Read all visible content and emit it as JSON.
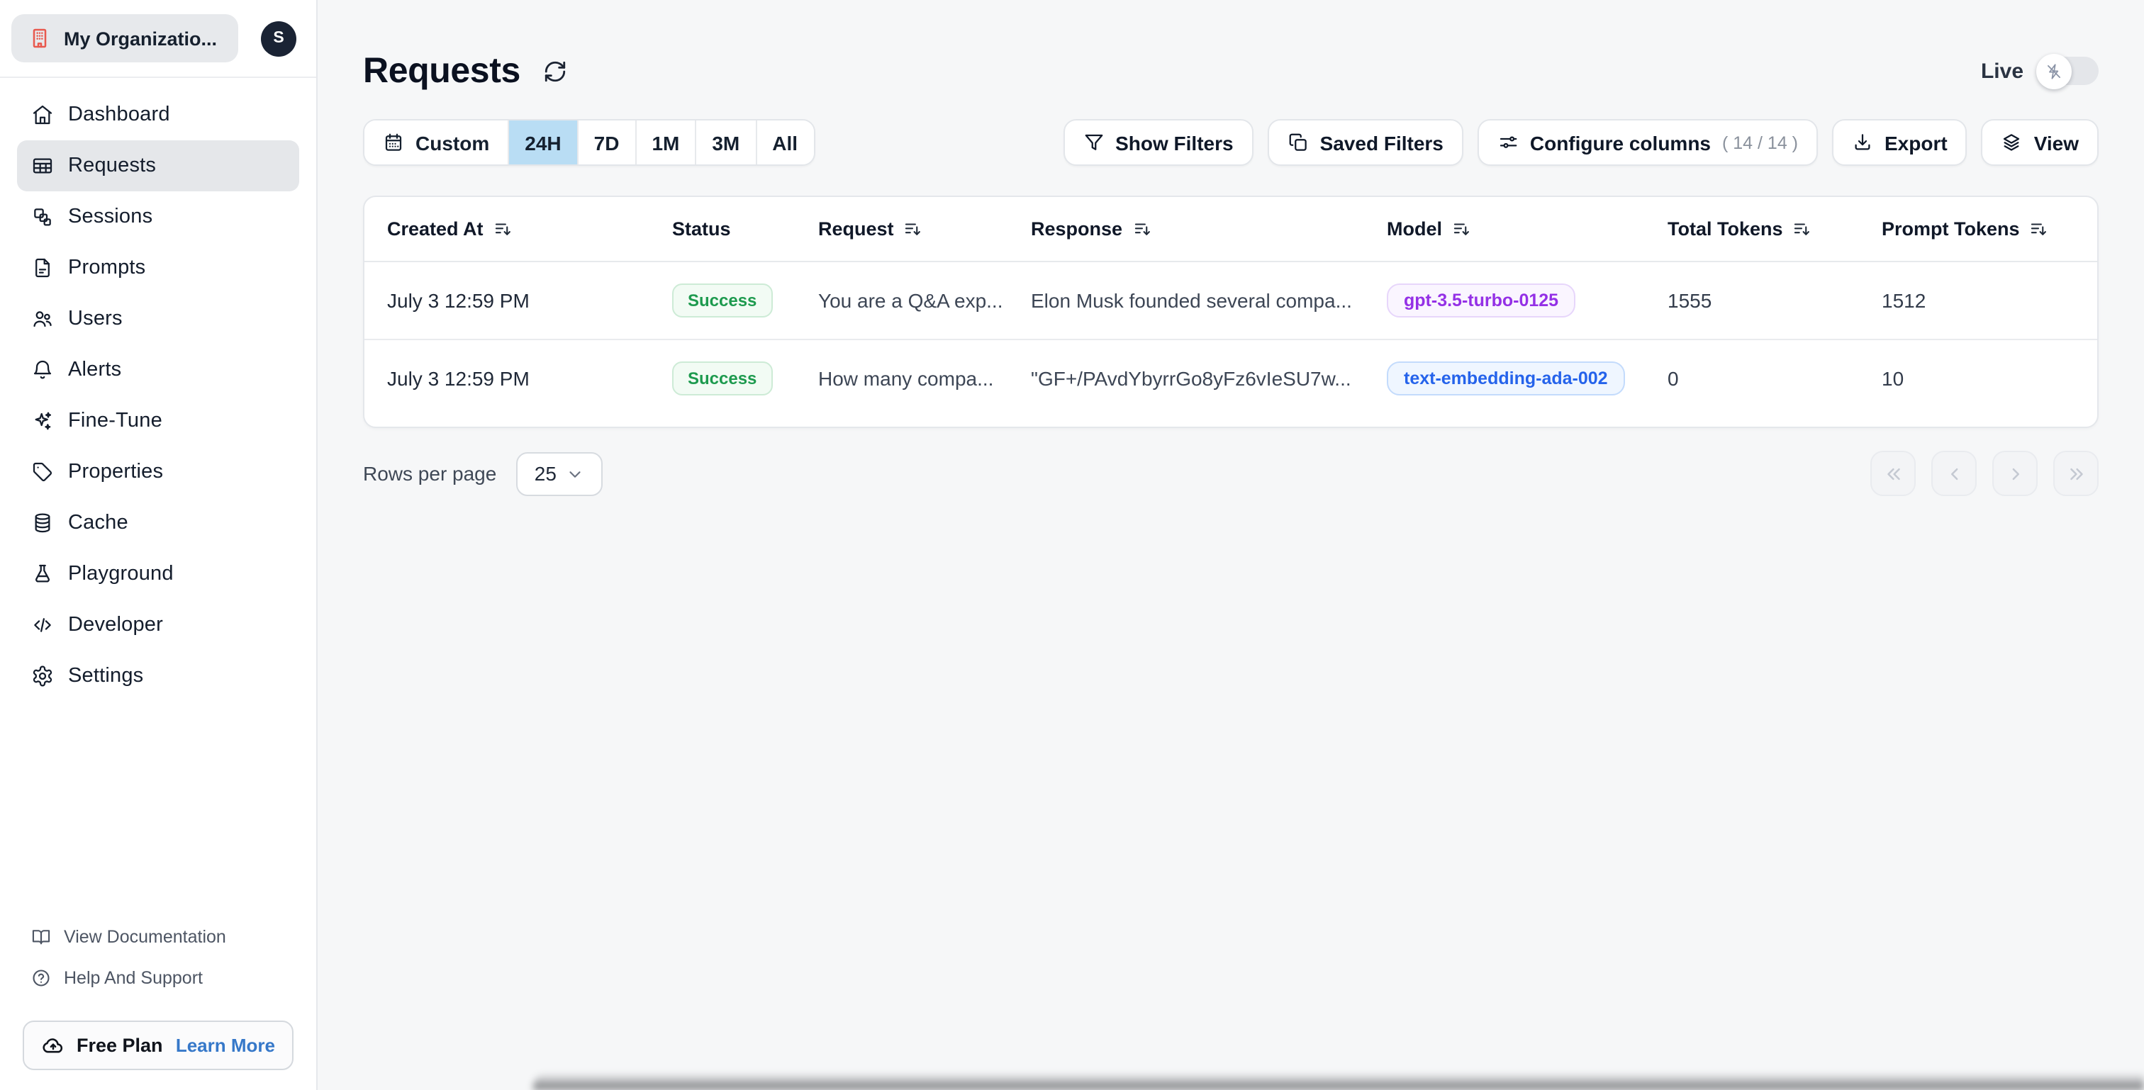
{
  "colors": {
    "page_bg": "#f6f7f8",
    "sidebar_bg": "#ffffff",
    "selected_range_bg": "#b9ddf4",
    "org_icon_color": "#e8594e",
    "success_text": "#1d9a4e",
    "model_purple": "#9430e6",
    "model_blue": "#2563eb",
    "learn_more_blue": "#3678c9"
  },
  "sidebar": {
    "org": {
      "name": "My Organizatio...",
      "avatar_initial": "S",
      "org_icon": "building-icon"
    },
    "items": [
      {
        "label": "Dashboard",
        "icon": "home-icon",
        "active": false
      },
      {
        "label": "Requests",
        "icon": "table-icon",
        "active": true
      },
      {
        "label": "Sessions",
        "icon": "sessions-icon",
        "active": false
      },
      {
        "label": "Prompts",
        "icon": "document-icon",
        "active": false
      },
      {
        "label": "Users",
        "icon": "users-icon",
        "active": false
      },
      {
        "label": "Alerts",
        "icon": "bell-icon",
        "active": false
      },
      {
        "label": "Fine-Tune",
        "icon": "sparkles-icon",
        "active": false
      },
      {
        "label": "Properties",
        "icon": "tag-icon",
        "active": false
      },
      {
        "label": "Cache",
        "icon": "database-icon",
        "active": false
      },
      {
        "label": "Playground",
        "icon": "flask-icon",
        "active": false
      },
      {
        "label": "Developer",
        "icon": "code-icon",
        "active": false
      },
      {
        "label": "Settings",
        "icon": "gear-icon",
        "active": false
      }
    ],
    "footer_links": [
      {
        "label": "View Documentation",
        "icon": "book-open-icon"
      },
      {
        "label": "Help And Support",
        "icon": "help-circle-icon"
      }
    ],
    "plan": {
      "label": "Free Plan",
      "icon": "cloud-upload-icon",
      "action": "Learn More"
    }
  },
  "header": {
    "title": "Requests",
    "refresh_icon": "refresh-icon",
    "live": {
      "label": "Live",
      "enabled": false,
      "knob_icon": "flash-slash-icon"
    }
  },
  "time_range": {
    "custom_label": "Custom",
    "custom_icon": "calendar-icon",
    "options": [
      "24H",
      "7D",
      "1M",
      "3M",
      "All"
    ],
    "selected": "24H"
  },
  "toolbar": {
    "show_filters": "Show Filters",
    "saved_filters": "Saved Filters",
    "configure_columns": "Configure columns",
    "configure_columns_count": "( 14 / 14 )",
    "export": "Export",
    "view": "View"
  },
  "table": {
    "columns": [
      {
        "label": "Created At",
        "sortable": true
      },
      {
        "label": "Status",
        "sortable": false
      },
      {
        "label": "Request",
        "sortable": true
      },
      {
        "label": "Response",
        "sortable": true
      },
      {
        "label": "Model",
        "sortable": true
      },
      {
        "label": "Total Tokens",
        "sortable": true
      },
      {
        "label": "Prompt Tokens",
        "sortable": true
      }
    ],
    "rows": [
      {
        "created_at": "July 3 12:59 PM",
        "status": "Success",
        "request": "You are a Q&A exp...",
        "response": "Elon Musk founded several compa...",
        "model": "gpt-3.5-turbo-0125",
        "model_color": "purple",
        "total_tokens": "1555",
        "prompt_tokens": "1512"
      },
      {
        "created_at": "July 3 12:59 PM",
        "status": "Success",
        "request": "How many compa...",
        "response": "\"GF+/PAvdYbyrrGo8yFz6vIeSU7w...",
        "model": "text-embedding-ada-002",
        "model_color": "blue",
        "total_tokens": "0",
        "prompt_tokens": "10"
      }
    ]
  },
  "pagination": {
    "rows_per_page_label": "Rows per page",
    "rows_per_page_value": "25",
    "buttons": [
      "first-page",
      "previous-page",
      "next-page",
      "last-page"
    ]
  }
}
